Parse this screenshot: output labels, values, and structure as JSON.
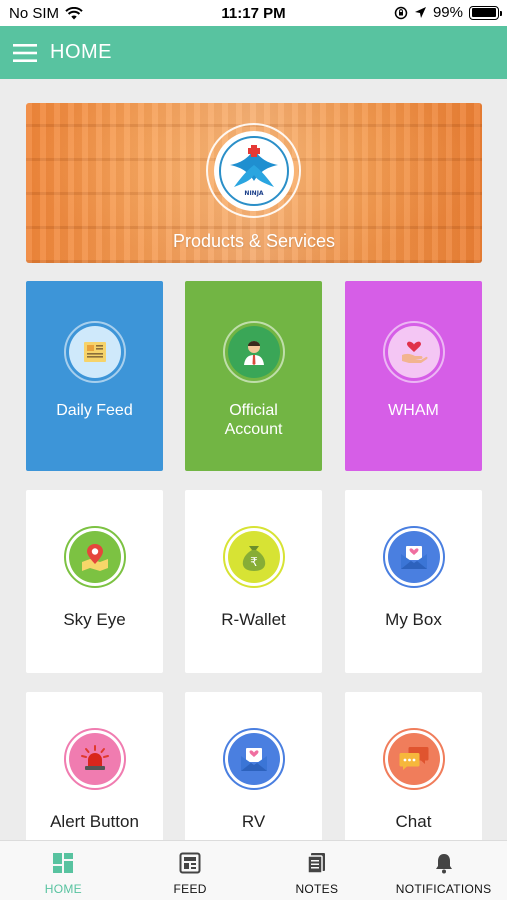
{
  "status_bar": {
    "carrier": "No SIM",
    "time": "11:17 PM",
    "battery_percent": "99%",
    "battery_level": 0.99
  },
  "app_bar": {
    "title": "HOME"
  },
  "banner": {
    "label": "Products & Services",
    "logo_text": "NINJA"
  },
  "top_tiles": [
    {
      "label": "Daily Feed",
      "color": "#3d95d8",
      "icon": "newspaper-icon"
    },
    {
      "label": "Official\nAccount",
      "color": "#72b544",
      "icon": "person-icon"
    },
    {
      "label": "WHAM",
      "color": "#d65ee7",
      "icon": "heart-hand-icon"
    }
  ],
  "grid_tiles": [
    {
      "label": "Sky Eye",
      "accent": "#7cc242",
      "icon": "map-pin-icon"
    },
    {
      "label": "R-Wallet",
      "accent": "#d7e334",
      "icon": "money-bag-icon"
    },
    {
      "label": "My Box",
      "accent": "#4a7fe0",
      "icon": "mail-heart-icon"
    },
    {
      "label": "Alert Button",
      "accent": "#f07cb0",
      "icon": "siren-icon"
    },
    {
      "label": "RV",
      "accent": "#4a7fe0",
      "icon": "envelope-heart-icon"
    },
    {
      "label": "Chat",
      "accent": "#f07d5b",
      "icon": "chat-bubbles-icon"
    }
  ],
  "bottom_nav": {
    "items": [
      {
        "label": "HOME",
        "icon": "dashboard-icon",
        "active": true
      },
      {
        "label": "FEED",
        "icon": "newspaper-icon",
        "active": false
      },
      {
        "label": "NOTES",
        "icon": "notes-icon",
        "active": false
      },
      {
        "label": "NOTIFICATIONS",
        "icon": "bell-icon",
        "active": false
      }
    ]
  },
  "colors": {
    "brand": "#58c3a0",
    "background": "#ececec"
  }
}
